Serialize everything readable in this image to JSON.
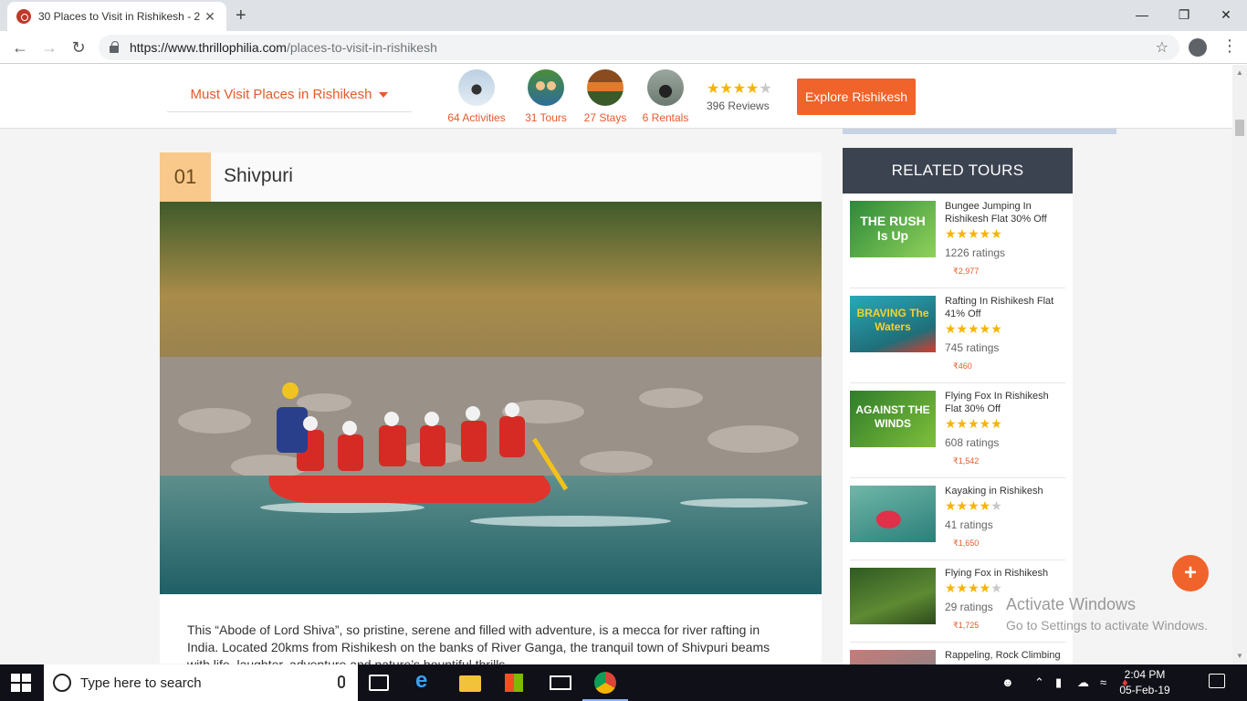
{
  "browser": {
    "tab_title": "30 Places to Visit in Rishikesh - 2",
    "tab_close": "✕",
    "new_tab": "+",
    "url_host": "https://www.thrillophilia.com",
    "url_path": "/places-to-visit-in-rishikesh",
    "win_min": "—",
    "win_max": "❐",
    "win_close": "✕"
  },
  "header": {
    "must_visit": "Must Visit Places in Rishikesh",
    "stats": [
      {
        "label": "64 Activities",
        "icon": "bike-stunt-icon"
      },
      {
        "label": "31 Tours",
        "icon": "rafting-group-icon"
      },
      {
        "label": "27 Stays",
        "icon": "camp-tents-icon"
      },
      {
        "label": "6 Rentals",
        "icon": "motorbike-icon"
      }
    ],
    "rating_stars": 4,
    "reviews": "396 Reviews",
    "explore_button": "Explore Rishikesh"
  },
  "article": {
    "number": "01",
    "name": "Shivpuri",
    "description": "This “Abode of Lord Shiva”, so pristine, serene and filled with adventure, is a mecca for river rafting in India. Located 20kms from Rishikesh on the banks of River Ganga, the tranquil town of Shivpuri beams with life, laughter, adventure and nature’s bountiful thrills."
  },
  "sidebar": {
    "heading": "RELATED TOURS",
    "tours": [
      {
        "name": "Bungee Jumping In Rishikesh Flat 30% Off",
        "stars": 5,
        "ratings": "1226 ratings",
        "price": "₹2,977",
        "thumb_text": "THE RUSH Is Up"
      },
      {
        "name": "Rafting In Rishikesh Flat 41% Off",
        "stars": 5,
        "ratings": "745 ratings",
        "price": "₹460",
        "thumb_text": "BRAVING The Waters"
      },
      {
        "name": "Flying Fox In Rishikesh Flat 30% Off",
        "stars": 5,
        "ratings": "608 ratings",
        "price": "₹1,542",
        "thumb_text": "AGAINST THE WINDS"
      },
      {
        "name": "Kayaking in Rishikesh",
        "stars": 4,
        "ratings": "41 ratings",
        "price": "₹1,650",
        "thumb_text": ""
      },
      {
        "name": "Flying Fox in Rishikesh",
        "stars": 4,
        "ratings": "29 ratings",
        "price": "₹1,725",
        "thumb_text": ""
      },
      {
        "name": "Rappeling, Rock Climbing",
        "stars": 0,
        "ratings": "",
        "price": "",
        "thumb_text": ""
      }
    ]
  },
  "overlay": {
    "fab": "+",
    "watermark_title": "Activate Windows",
    "watermark_sub": "Go to Settings to activate Windows."
  },
  "taskbar": {
    "search_placeholder": "Type here to search",
    "time": "2:04 PM",
    "date": "05-Feb-19"
  },
  "colors": {
    "accent": "#f0632a",
    "sidebar_header": "#3c4350",
    "number_box": "#f9c98b",
    "star": "#f5b400"
  }
}
